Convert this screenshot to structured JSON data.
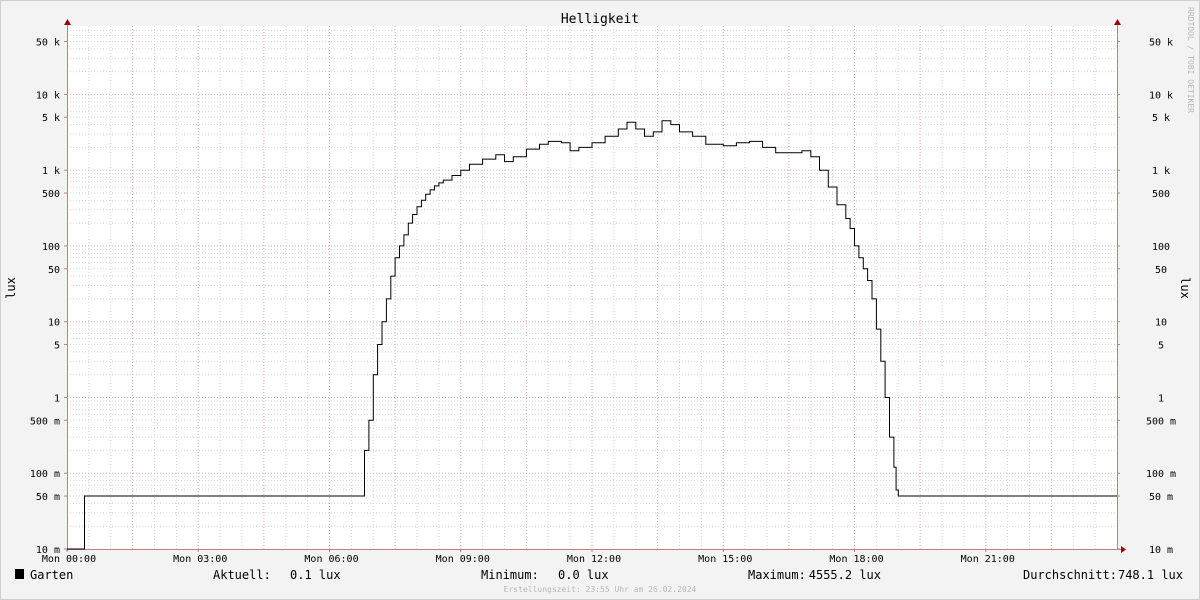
{
  "watermark": "RRDTOOL / TOBI OETIKER",
  "footer": "Erstellungszeit: 23:55 Uhr am 26.02.2024",
  "legend": {
    "series_name": "Garten",
    "series_color": "#000000",
    "current_label": "Aktuell:",
    "current_value": "0.1 lux",
    "min_label": "Minimum:",
    "min_value": "0.0 lux",
    "max_label": "Maximum:",
    "max_value": "4555.2 lux",
    "avg_label": "Durchschnitt:",
    "avg_value": "748.1 lux"
  },
  "colors": {
    "background": "#f3f3f3",
    "canvas": "#ffffff",
    "grid_minor": "#d7d7d7",
    "grid_major": "#e6a8b4",
    "axis": "#c08080",
    "arrow": "#a00000",
    "line": "#000000"
  },
  "chart_data": {
    "type": "line",
    "title": "Helligkeit",
    "ylabel": "lux",
    "y_scale": "log",
    "ylim": [
      0.01,
      80000
    ],
    "xlim_hours": [
      0,
      24
    ],
    "grid": true,
    "legend_position": "bottom",
    "y_ticks": [
      {
        "value": 0.01,
        "label": "10 m"
      },
      {
        "value": 0.05,
        "label": "50 m"
      },
      {
        "value": 0.1,
        "label": "100 m"
      },
      {
        "value": 0.5,
        "label": "500 m"
      },
      {
        "value": 1,
        "label": "1"
      },
      {
        "value": 5,
        "label": "5"
      },
      {
        "value": 10,
        "label": "10"
      },
      {
        "value": 50,
        "label": "50"
      },
      {
        "value": 100,
        "label": "100"
      },
      {
        "value": 500,
        "label": "500"
      },
      {
        "value": 1000,
        "label": "1 k"
      },
      {
        "value": 5000,
        "label": "5 k"
      },
      {
        "value": 10000,
        "label": "10 k"
      },
      {
        "value": 50000,
        "label": "50 k"
      }
    ],
    "x_ticks": [
      {
        "hour": 0,
        "label": "Mon 00:00"
      },
      {
        "hour": 3,
        "label": "Mon 03:00"
      },
      {
        "hour": 6,
        "label": "Mon 06:00"
      },
      {
        "hour": 9,
        "label": "Mon 09:00"
      },
      {
        "hour": 12,
        "label": "Mon 12:00"
      },
      {
        "hour": 15,
        "label": "Mon 15:00"
      },
      {
        "hour": 18,
        "label": "Mon 18:00"
      },
      {
        "hour": 21,
        "label": "Mon 21:00"
      }
    ],
    "series": [
      {
        "name": "Garten",
        "points": [
          [
            0.0,
            0.01
          ],
          [
            0.35,
            0.01
          ],
          [
            0.4,
            0.05
          ],
          [
            6.75,
            0.05
          ],
          [
            6.8,
            0.2
          ],
          [
            6.9,
            0.5
          ],
          [
            7.0,
            2
          ],
          [
            7.1,
            5
          ],
          [
            7.2,
            10
          ],
          [
            7.3,
            20
          ],
          [
            7.4,
            40
          ],
          [
            7.5,
            70
          ],
          [
            7.6,
            100
          ],
          [
            7.7,
            140
          ],
          [
            7.8,
            200
          ],
          [
            7.9,
            260
          ],
          [
            8.0,
            330
          ],
          [
            8.1,
            400
          ],
          [
            8.2,
            480
          ],
          [
            8.3,
            550
          ],
          [
            8.4,
            620
          ],
          [
            8.5,
            680
          ],
          [
            8.6,
            740
          ],
          [
            8.8,
            850
          ],
          [
            9.0,
            1000
          ],
          [
            9.2,
            1200
          ],
          [
            9.5,
            1400
          ],
          [
            9.8,
            1600
          ],
          [
            10.0,
            1300
          ],
          [
            10.2,
            1500
          ],
          [
            10.5,
            1900
          ],
          [
            10.8,
            2200
          ],
          [
            11.0,
            2400
          ],
          [
            11.3,
            2300
          ],
          [
            11.5,
            1800
          ],
          [
            11.7,
            2000
          ],
          [
            12.0,
            2300
          ],
          [
            12.3,
            2800
          ],
          [
            12.6,
            3500
          ],
          [
            12.8,
            4300
          ],
          [
            13.0,
            3500
          ],
          [
            13.2,
            2800
          ],
          [
            13.4,
            3200
          ],
          [
            13.6,
            4500
          ],
          [
            13.8,
            4000
          ],
          [
            14.0,
            3200
          ],
          [
            14.3,
            2800
          ],
          [
            14.6,
            2200
          ],
          [
            15.0,
            2100
          ],
          [
            15.3,
            2300
          ],
          [
            15.6,
            2400
          ],
          [
            15.9,
            2000
          ],
          [
            16.2,
            1700
          ],
          [
            16.5,
            1700
          ],
          [
            16.8,
            1800
          ],
          [
            17.0,
            1500
          ],
          [
            17.2,
            1000
          ],
          [
            17.4,
            600
          ],
          [
            17.6,
            350
          ],
          [
            17.8,
            230
          ],
          [
            17.9,
            170
          ],
          [
            18.0,
            100
          ],
          [
            18.1,
            70
          ],
          [
            18.2,
            50
          ],
          [
            18.3,
            35
          ],
          [
            18.4,
            20
          ],
          [
            18.5,
            8
          ],
          [
            18.6,
            3
          ],
          [
            18.7,
            1
          ],
          [
            18.8,
            0.3
          ],
          [
            18.9,
            0.12
          ],
          [
            18.95,
            0.06
          ],
          [
            19.0,
            0.05
          ],
          [
            24.0,
            0.05
          ]
        ]
      }
    ]
  }
}
